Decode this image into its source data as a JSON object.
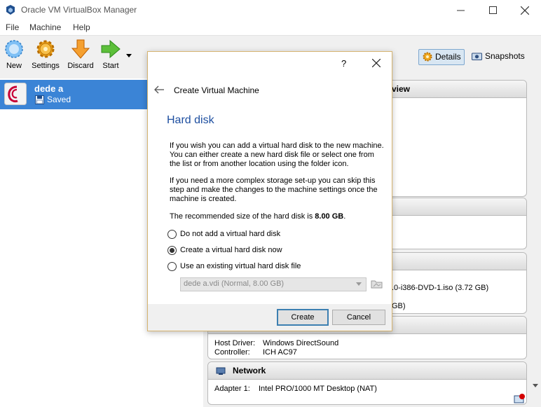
{
  "window": {
    "title": "Oracle VM VirtualBox Manager"
  },
  "menu": {
    "items": [
      "File",
      "Machine",
      "Help"
    ]
  },
  "toolbar": {
    "new_label": "New",
    "settings_label": "Settings",
    "discard_label": "Discard",
    "start_label": "Start",
    "details_label": "Details",
    "snapshots_label": "Snapshots"
  },
  "vm_list": [
    {
      "name": "dede a",
      "state": "Saved"
    }
  ],
  "details": {
    "preview_fragment": "view",
    "storage_iso_fragment": ".0-i386-DVD-1.iso (3.72 GB)",
    "storage_gb_fragment": "GB)",
    "audio": {
      "host_driver_label": "Host Driver:",
      "host_driver_value": "Windows DirectSound",
      "controller_label": "Controller:",
      "controller_value": "ICH AC97"
    },
    "network": {
      "title": "Network",
      "adapter_label": "Adapter 1:",
      "adapter_value": "Intel PRO/1000 MT Desktop (NAT)"
    }
  },
  "dialog": {
    "help_glyph": "?",
    "header": "Create Virtual Machine",
    "page_title": "Hard disk",
    "para1": "If you wish you can add a virtual hard disk to the new machine. You can either create a new hard disk file or select one from the list or from another location using the folder icon.",
    "para2": "If you need a more complex storage set-up you can skip this step and make the changes to the machine settings once the machine is created.",
    "recommended_prefix": "The recommended size of the hard disk is ",
    "recommended_size": "8.00 GB",
    "recommended_suffix": ".",
    "options": {
      "none": "Do not add a virtual hard disk",
      "create": "Create a virtual hard disk now",
      "existing": "Use an existing virtual hard disk file"
    },
    "selected_option": "create",
    "existing_file_value": "dede a.vdi (Normal, 8.00 GB)",
    "create_button": "Create",
    "cancel_button": "Cancel"
  }
}
